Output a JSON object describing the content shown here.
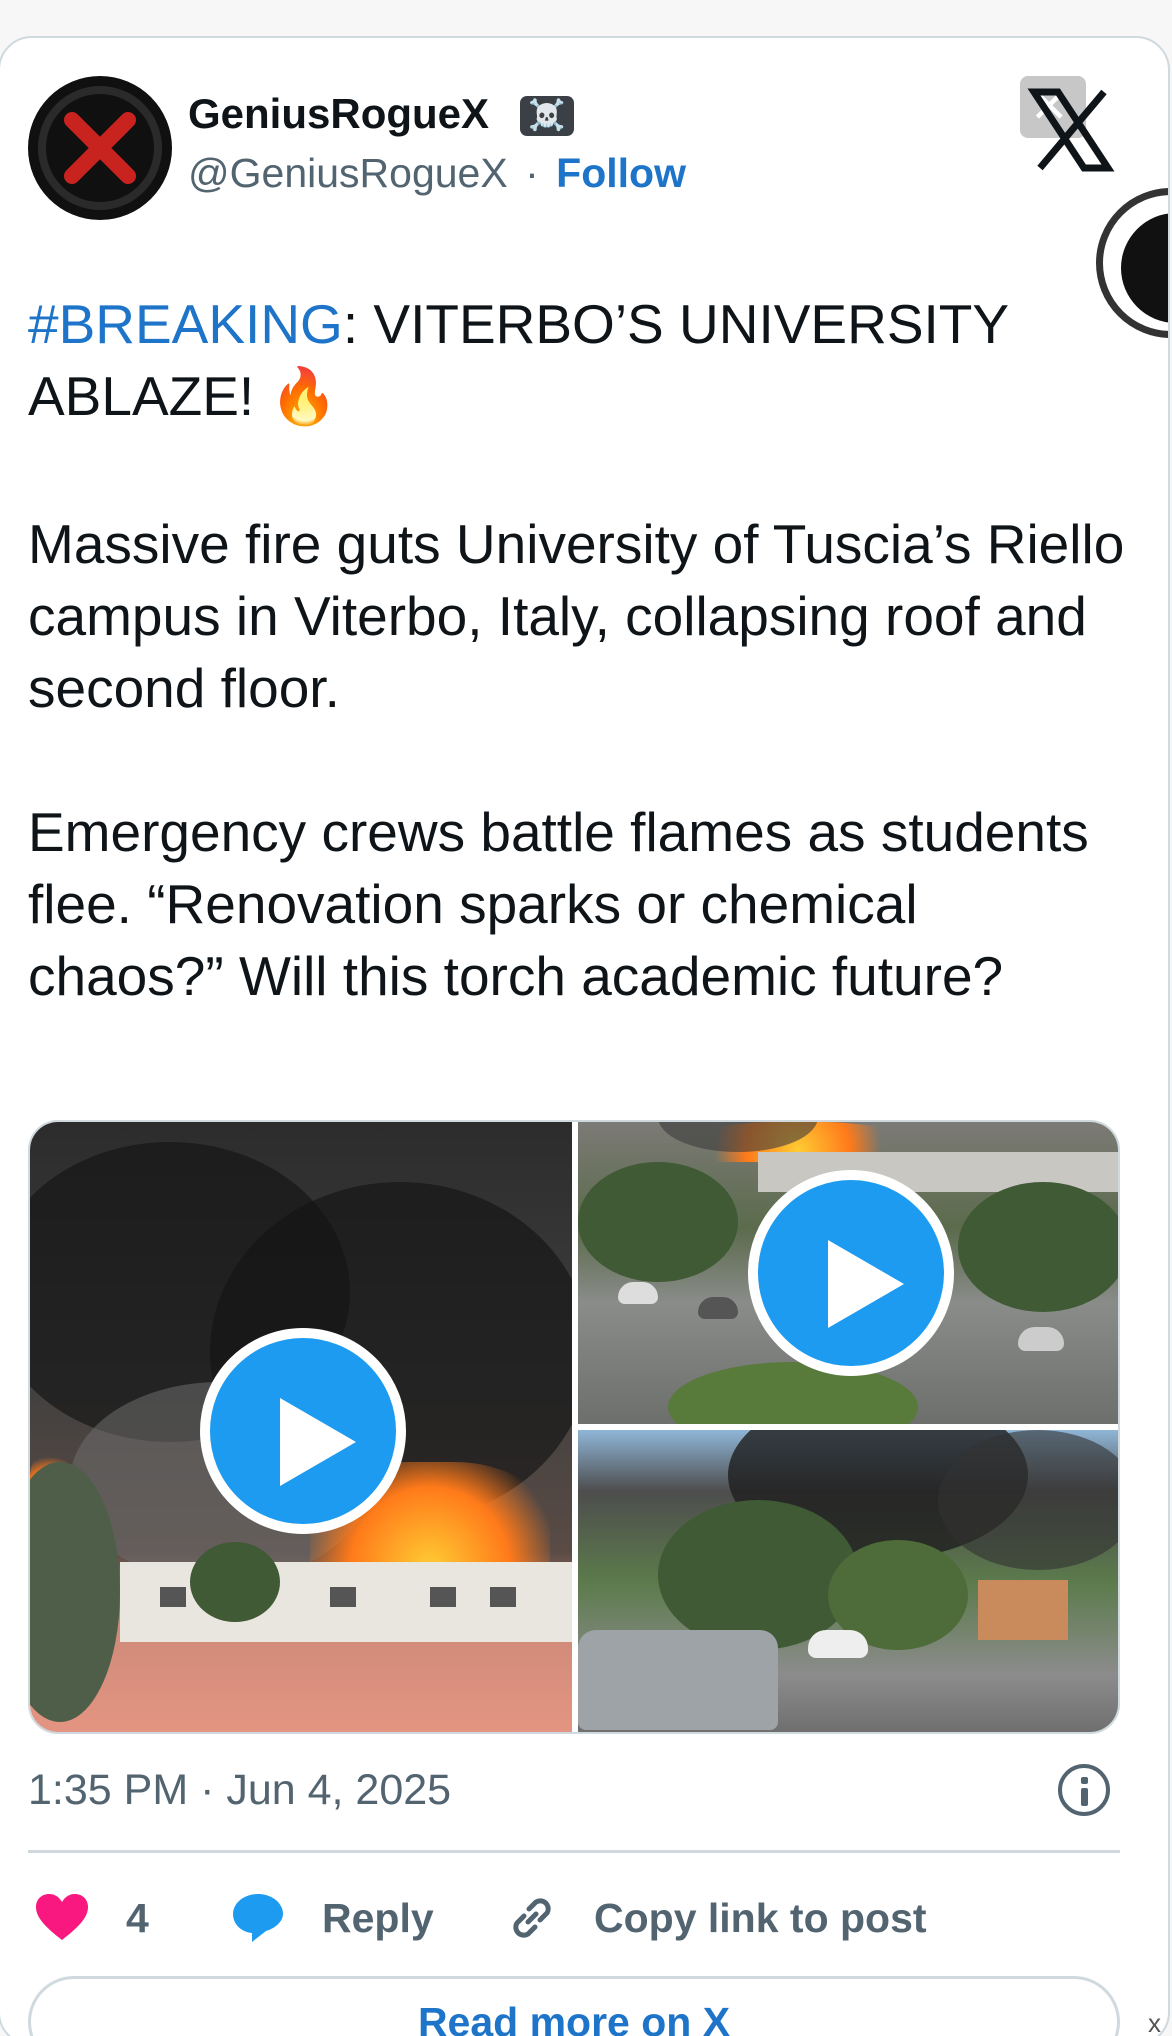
{
  "author": {
    "name": "GeniusRogueX",
    "badge_emoji": "☠️",
    "handle": "@GeniusRogueX",
    "separator": "·",
    "follow_label": "Follow"
  },
  "close": {
    "glyph": "✕"
  },
  "post": {
    "hashtag": "#BREAKING",
    "headline_rest": ": VITERBO’S UNIVERSITY ABLAZE! 🔥",
    "paragraph_1": "Massive fire guts University of Tuscia’s Riello campus in Viterbo, Italy, collapsing roof and second floor.",
    "paragraph_2": "Emergency crews battle flames as students flee. “Renovation sparks or chemical chaos?” Will this torch academic future?"
  },
  "media": {
    "items": [
      {
        "kind": "video",
        "description_icon": "play-icon"
      },
      {
        "kind": "video",
        "description_icon": "play-icon"
      },
      {
        "kind": "image"
      }
    ]
  },
  "timestamp": "1:35 PM · Jun 4, 2025",
  "actions": {
    "like_count": "4",
    "reply_label": "Reply",
    "copy_label": "Copy link to post"
  },
  "read_more_label": "Read more on X",
  "corner_glyph": "x",
  "colors": {
    "link": "#1d74c9",
    "play": "#1d9bf0",
    "heart": "#f91880",
    "reply": "#1d9bf0",
    "muted": "#536471"
  }
}
